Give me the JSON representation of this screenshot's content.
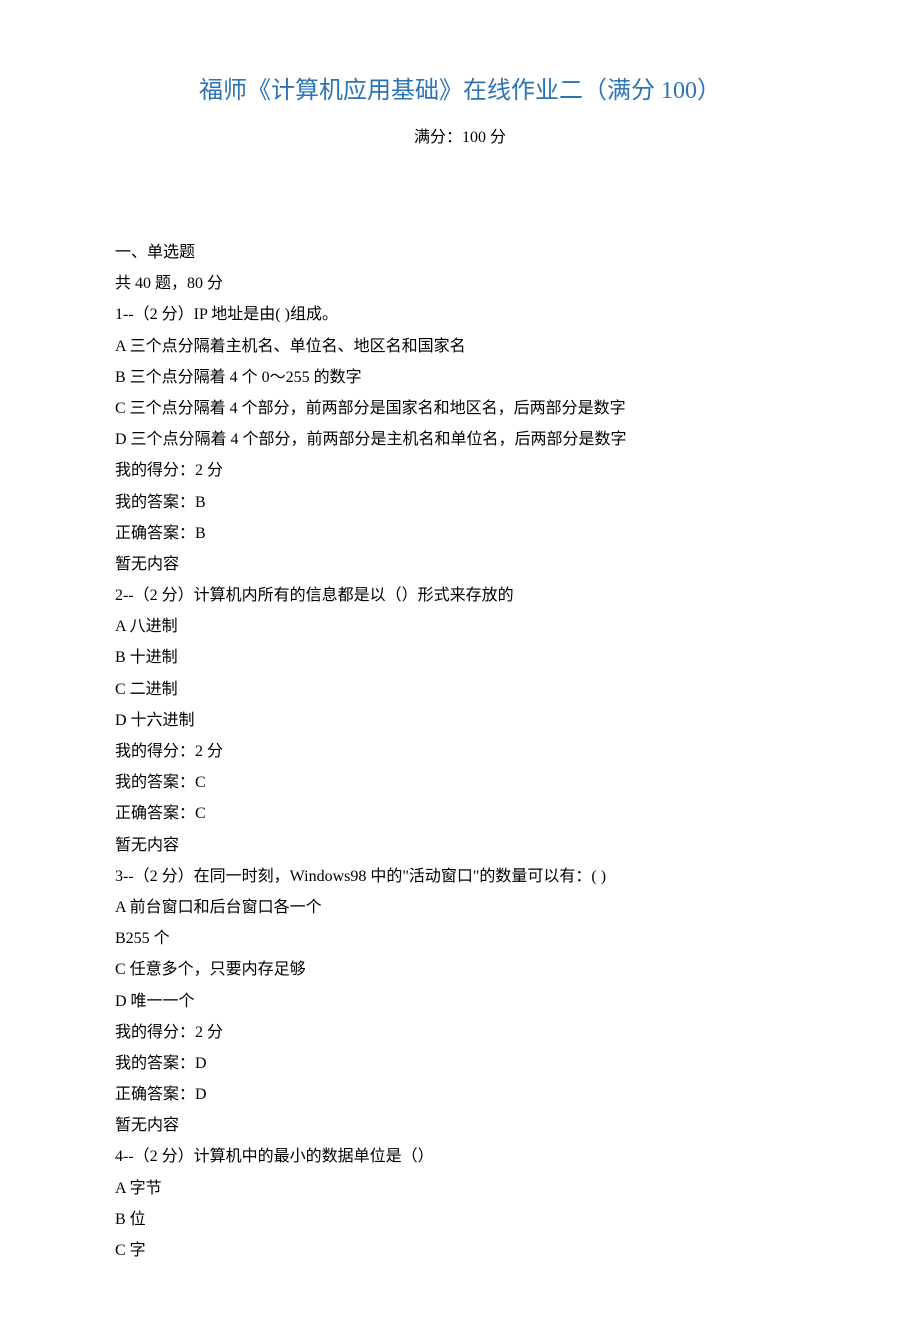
{
  "title": "福师《计算机应用基础》在线作业二（满分 100）",
  "subtitle": "满分：100 分",
  "section_heading": "一、单选题",
  "section_info": "共 40 题，80 分",
  "questions": [
    {
      "stem": "1--（2 分）IP 地址是由( )组成。",
      "options": [
        "A 三个点分隔着主机名、单位名、地区名和国家名",
        "B 三个点分隔着 4 个 0～255 的数字",
        "C 三个点分隔着 4 个部分，前两部分是国家名和地区名，后两部分是数字",
        "D 三个点分隔着 4 个部分，前两部分是主机名和单位名，后两部分是数字"
      ],
      "my_score": "我的得分：2 分",
      "my_answer": "我的答案：B",
      "correct_answer": "正确答案：B",
      "note": "暂无内容"
    },
    {
      "stem": "2--（2 分）计算机内所有的信息都是以（）形式来存放的",
      "options": [
        "A 八进制",
        "B 十进制",
        "C 二进制",
        "D 十六进制"
      ],
      "my_score": "我的得分：2 分",
      "my_answer": "我的答案：C",
      "correct_answer": "正确答案：C",
      "note": "暂无内容"
    },
    {
      "stem": "3--（2 分）在同一时刻，Windows98 中的\"活动窗口\"的数量可以有：( )",
      "options": [
        "A 前台窗口和后台窗口各一个",
        "B255 个",
        "C 任意多个，只要内存足够",
        "D 唯一一个"
      ],
      "my_score": "我的得分：2 分",
      "my_answer": "我的答案：D",
      "correct_answer": "正确答案：D",
      "note": "暂无内容"
    },
    {
      "stem": "4--（2 分）计算机中的最小的数据单位是（）",
      "options": [
        "A 字节",
        "B 位",
        "C 字"
      ]
    }
  ]
}
